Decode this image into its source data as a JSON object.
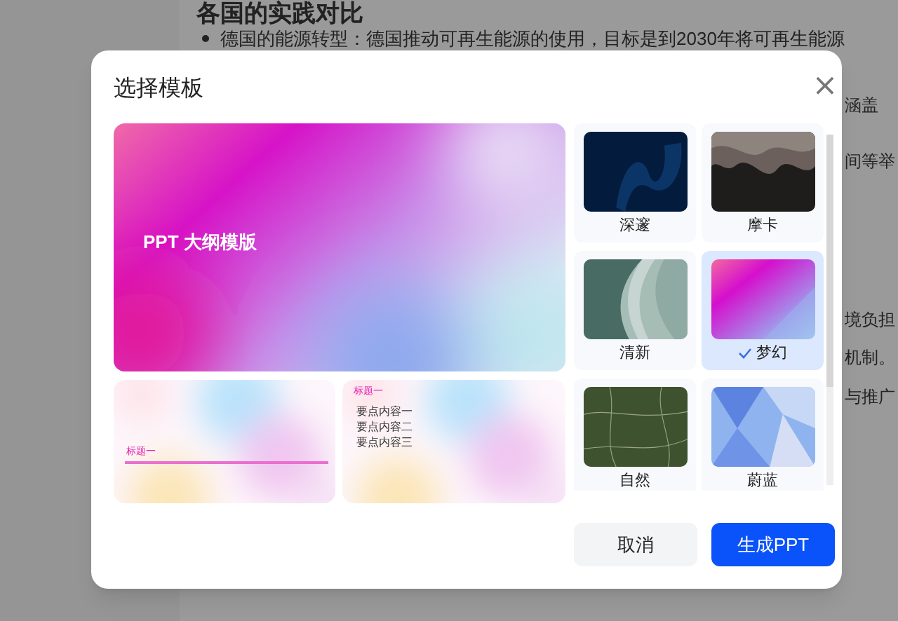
{
  "background_page": {
    "heading": "各国的实践对比",
    "bullet": "德国的能源转型：德国推动可再生能源的使用，目标是到2030年将可再生能源",
    "fragments": [
      "涵盖",
      "间等举",
      "境负担",
      "机制。",
      "与推广"
    ]
  },
  "dialog": {
    "title": "选择模板",
    "close": "×",
    "preview": {
      "title": "PPT 大纲模版",
      "slide_1": {
        "heading": "标题一"
      },
      "slide_2": {
        "heading": "标题一",
        "points": [
          "要点内容一",
          "要点内容二",
          "要点内容三"
        ]
      }
    },
    "templates": [
      {
        "name": "深邃",
        "selected": false
      },
      {
        "name": "摩卡",
        "selected": false
      },
      {
        "name": "清新",
        "selected": false
      },
      {
        "name": "梦幻",
        "selected": true
      },
      {
        "name": "自然",
        "selected": false
      },
      {
        "name": "蔚蓝",
        "selected": false
      }
    ],
    "buttons": [
      {
        "label": "取消",
        "kind": "secondary"
      },
      {
        "label": "生成PPT",
        "kind": "primary"
      }
    ]
  }
}
